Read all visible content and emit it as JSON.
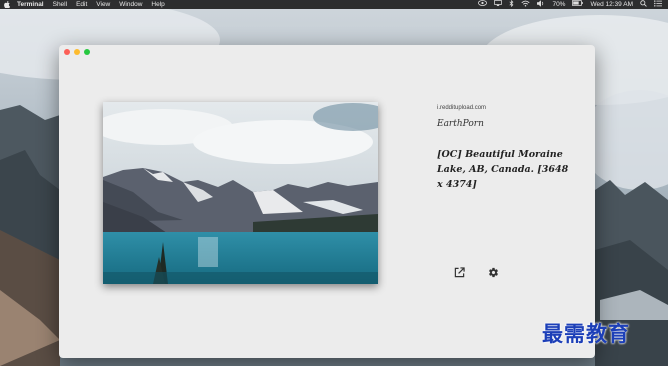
{
  "menubar": {
    "app_name": "Terminal",
    "items": [
      "Shell",
      "Edit",
      "View",
      "Window",
      "Help"
    ],
    "battery": "70%",
    "clock": "Wed 12:39 AM"
  },
  "post": {
    "domain": "i.redditupload.com",
    "subreddit": "EarthPorn",
    "title": "[OC] Beautiful Moraine Lake, AB, Canada. [3648 x 4374]"
  },
  "watermark": "最需教育",
  "colors": {
    "window_bg": "#ececec",
    "traffic_close": "#fc5f57",
    "traffic_minimize": "#fdbb2e",
    "traffic_maximize": "#27c840"
  },
  "icons": {
    "open": "open-external-icon",
    "settings": "gear-icon"
  }
}
